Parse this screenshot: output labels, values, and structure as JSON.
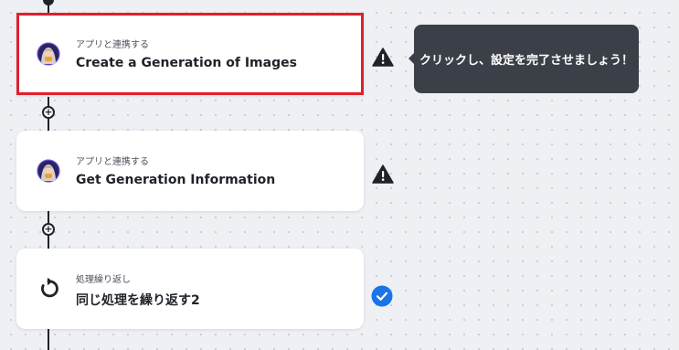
{
  "steps": [
    {
      "category": "アプリと連携する",
      "title": "Create a Generation of Images",
      "icon": "ai-app-avatar-icon",
      "status": "warning-icon",
      "selected": true
    },
    {
      "category": "アプリと連携する",
      "title": "Get Generation Information",
      "icon": "ai-app-avatar-icon",
      "status": "warning-icon",
      "selected": false
    },
    {
      "category": "処理繰り返し",
      "title": "同じ処理を繰り返す2",
      "icon": "loop-repeat-icon",
      "status": "check-icon",
      "selected": false
    }
  ],
  "tooltip": {
    "text": "クリックし、設定を完了させましょう！"
  },
  "colors": {
    "selected_border": "#e0202a",
    "tooltip_bg": "#3b3f47",
    "check_blue": "#1a73e8",
    "warning": "#1f2329",
    "canvas_bg": "#eef0f4"
  }
}
